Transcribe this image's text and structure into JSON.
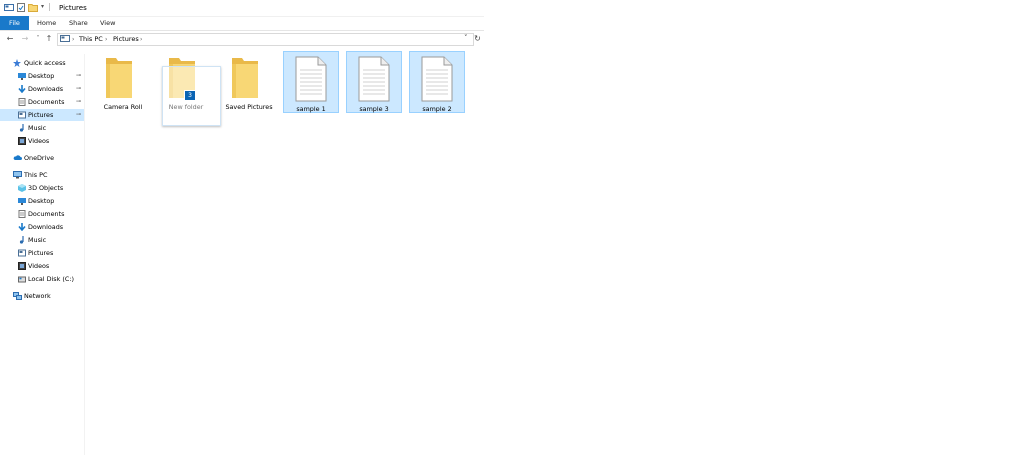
{
  "window": {
    "title": "Pictures"
  },
  "ribbon": {
    "tabs": [
      "File",
      "Home",
      "Share",
      "View"
    ]
  },
  "address": {
    "crumbs": [
      "This PC",
      "Pictures"
    ]
  },
  "sidebar": {
    "quick_access": "Quick access",
    "quick_items": [
      "Desktop",
      "Downloads",
      "Documents",
      "Pictures",
      "Music",
      "Videos"
    ],
    "onedrive": "OneDrive",
    "this_pc": "This PC",
    "pc_items": [
      "3D Objects",
      "Desktop",
      "Documents",
      "Downloads",
      "Music",
      "Pictures",
      "Videos",
      "Local Disk (C:)"
    ],
    "network": "Network"
  },
  "files": [
    {
      "name": "Camera Roll",
      "type": "folder",
      "selected": false
    },
    {
      "name": "New folder",
      "type": "folder",
      "selected": false
    },
    {
      "name": "Saved Pictures",
      "type": "folder",
      "selected": false
    },
    {
      "name": "sample 1",
      "type": "file",
      "selected": true
    },
    {
      "name": "sample 3",
      "type": "file",
      "selected": true
    },
    {
      "name": "sample 2",
      "type": "file",
      "selected": true
    }
  ],
  "drag": {
    "count": "3"
  },
  "colors": {
    "accent": "#1979ca",
    "selection": "#cce8ff",
    "folder": "#f8d775"
  },
  "icons": {
    "pin": "pin-icon",
    "folder": "folder-icon",
    "document": "document-icon"
  }
}
